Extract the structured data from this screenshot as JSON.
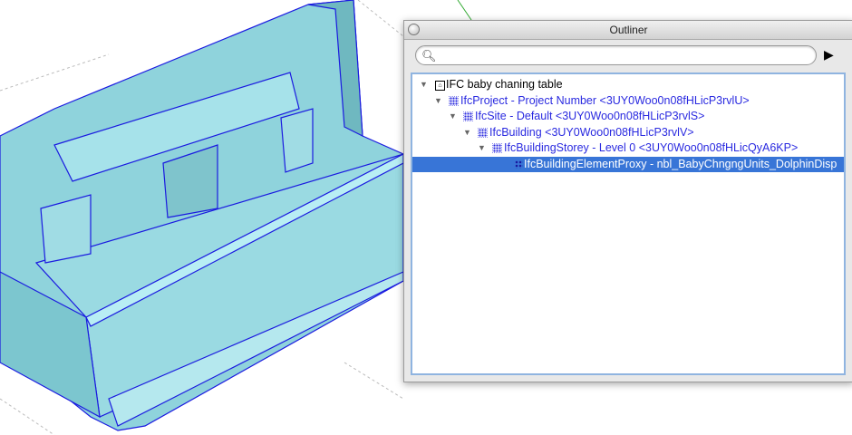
{
  "outliner": {
    "title": "Outliner",
    "search": {
      "value": "",
      "placeholder": ""
    },
    "icons": {
      "search": "search-icon",
      "details": "details-arrow-icon",
      "close": "close-icon"
    },
    "tree": [
      {
        "label": "IFC baby chaning table",
        "level": 0,
        "expanded": true,
        "icon": "model-icon",
        "selected": false
      },
      {
        "label": "IfcProject - Project Number <3UY0Woo0n08fHLicP3rvlU>",
        "level": 1,
        "expanded": true,
        "icon": "group-icon",
        "selected": false
      },
      {
        "label": "IfcSite - Default <3UY0Woo0n08fHLicP3rvlS>",
        "level": 2,
        "expanded": true,
        "icon": "group-icon",
        "selected": false
      },
      {
        "label": "IfcBuilding <3UY0Woo0n08fHLicP3rvlV>",
        "level": 3,
        "expanded": true,
        "icon": "group-icon",
        "selected": false
      },
      {
        "label": "IfcBuildingStorey - Level 0 <3UY0Woo0n08fHLicQyA6KP>",
        "level": 4,
        "expanded": true,
        "icon": "group-icon",
        "selected": false
      },
      {
        "label": "IfcBuildingElementProxy - nbl_BabyChngngUnits_DolphinDisp",
        "level": 5,
        "expanded": false,
        "icon": "component-icon",
        "selected": true
      }
    ]
  },
  "colors": {
    "model": "#8fd3dc",
    "edge": "#1a1ae0",
    "selection": "#3875d7",
    "link": "#2a2ae0"
  }
}
